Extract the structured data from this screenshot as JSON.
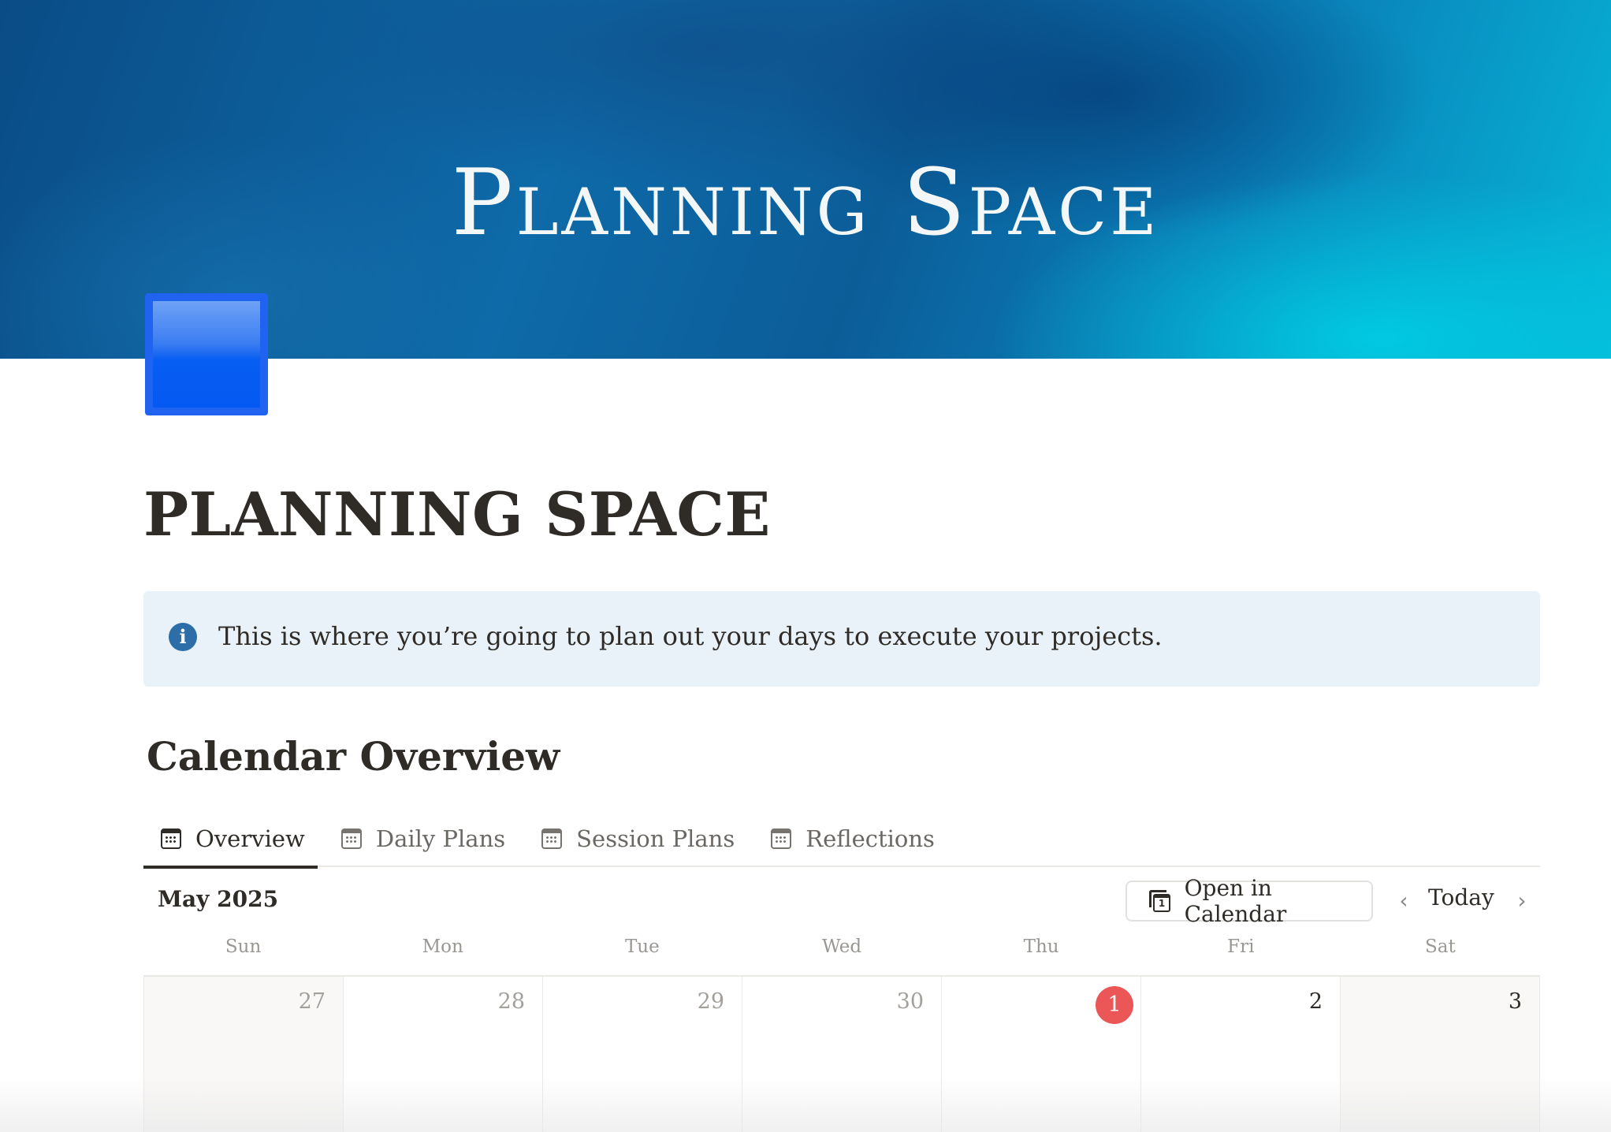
{
  "cover": {
    "title": "Planning Space"
  },
  "page": {
    "title": "PLANNING SPACE"
  },
  "callout": {
    "icon": "i",
    "text": "This is where you’re going to plan out your days to execute your projects."
  },
  "section": {
    "heading": "Calendar Overview"
  },
  "tabs": [
    {
      "label": "Overview",
      "active": true
    },
    {
      "label": "Daily Plans",
      "active": false
    },
    {
      "label": "Session Plans",
      "active": false
    },
    {
      "label": "Reflections",
      "active": false
    }
  ],
  "calendar": {
    "month_label": "May 2025",
    "open_button": "Open in Calendar",
    "open_icon_number": "1",
    "today_label": "Today",
    "prev_icon": "‹",
    "next_icon": "›",
    "weekdays": [
      "Sun",
      "Mon",
      "Tue",
      "Wed",
      "Thu",
      "Fri",
      "Sat"
    ],
    "days": [
      "27",
      "28",
      "29",
      "30",
      "1",
      "2",
      "3"
    ],
    "today_day": "1"
  },
  "colors": {
    "today_badge": "#eb5757",
    "page_icon": "#0459f2",
    "callout_bg": "#e8f2f8"
  }
}
